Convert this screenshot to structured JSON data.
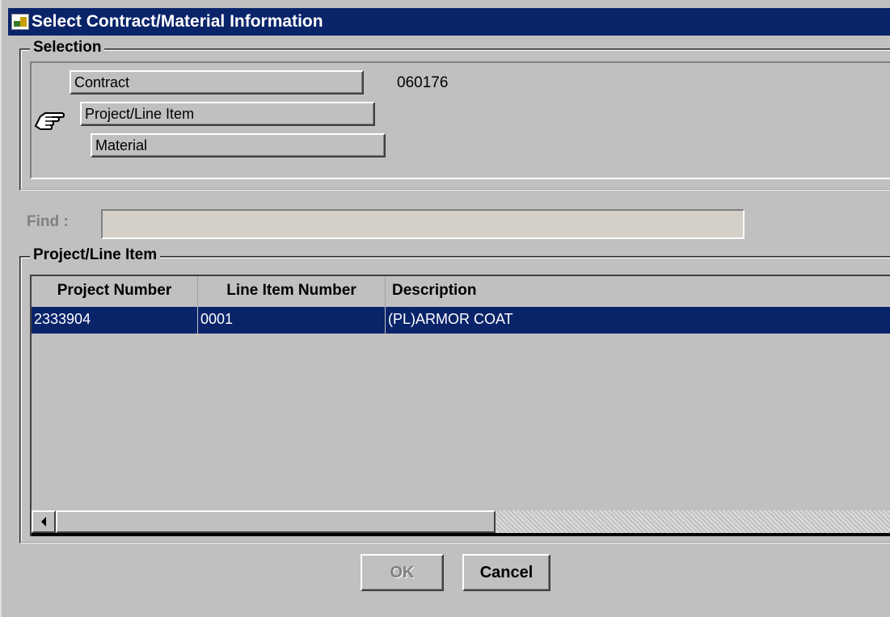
{
  "window": {
    "title": "Select Contract/Material Information"
  },
  "selection": {
    "legend": "Selection",
    "contract_label": "Contract",
    "contract_value": "060176",
    "project_line_item_label": "Project/Line Item",
    "material_label": "Material",
    "current_pointer_icon": "hand-pointing-right-icon"
  },
  "find": {
    "label": "Find :",
    "value": "",
    "disabled": true
  },
  "project_line_item": {
    "legend": "Project/Line Item",
    "columns": [
      "Project Number",
      "Line Item Number",
      "Description"
    ],
    "rows": [
      {
        "project_number": "2333904",
        "line_item_number": "0001",
        "description": "(PL)ARMOR COAT",
        "selected": true
      }
    ]
  },
  "buttons": {
    "ok_label": "OK",
    "cancel_label": "Cancel"
  },
  "colors": {
    "title_bar": "#0a246a",
    "selected_row": "#0a246a",
    "window_bg": "#c0c0c0"
  }
}
